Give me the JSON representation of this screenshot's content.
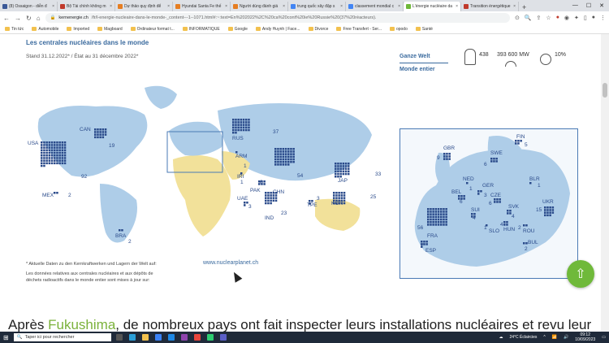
{
  "tabs": [
    {
      "label": "(8) Ossaigon - diễn đ",
      "color": "#3b5998"
    },
    {
      "label": "Bộ Tài chính không m",
      "color": "#c0392b"
    },
    {
      "label": "Dự thảo quy định để",
      "color": "#e67e22"
    },
    {
      "label": "Hyundai Santa Fe thế",
      "color": "#e67e22"
    },
    {
      "label": "Người dùng đánh giá",
      "color": "#e67e22"
    },
    {
      "label": "trung quốc xây đập s",
      "color": "#4285f4"
    },
    {
      "label": "classement mondial c",
      "color": "#4285f4"
    },
    {
      "label": "L'énergie nucléaire da",
      "color": "#6fb93a",
      "active": true
    },
    {
      "label": "Transition énergétique",
      "color": "#c0392b"
    }
  ],
  "toolbar": {
    "url_host": "kernenergie.ch",
    "url_path": "/fr/l-energie-nucleaire-dans-le-monde-_content---1--1071.html#:~:text=En%202022%2C%20ca%20cont%20ie%20Russie%20(37%20réacteurs)."
  },
  "bookmarks": [
    "Tin tức",
    "Automobile",
    "Imported",
    "Magboard",
    "Ordinateur format t...",
    "INFORMATIQUE",
    "Google",
    "Andy Huynh | Face...",
    "Divorce",
    "Free Transfert - Ser...",
    "opodo",
    "Santé"
  ],
  "map": {
    "title": "Les centrales nucléaires dans le monde",
    "subtitle": "Stand 31.12.2022* / État au 31 décembre 2022*",
    "world_label_de": "Ganze Welt",
    "world_label_fr": "Monde entier",
    "total_reactors": "438",
    "total_capacity": "393 600 MW",
    "share": "10%",
    "footnote_de": "* Aktuelle Daten zu den Kernkraftwerken und Lagern der Welt auf:",
    "footnote_fr_1": "Les données relatives aux centrales nucléaires et aux dépôts de",
    "footnote_fr_2": "déchets radioactifs dans le monde entier sont mises à jour sur:",
    "site": "www.nuclearplanet.ch",
    "world_countries": [
      {
        "code": "CAN",
        "count": "19"
      },
      {
        "code": "USA",
        "count": "92"
      },
      {
        "code": "MEX",
        "count": "2"
      },
      {
        "code": "BRA",
        "count": "2"
      },
      {
        "code": "ARG",
        "count": "3"
      },
      {
        "code": "RSA",
        "count": "2"
      },
      {
        "code": "RUS",
        "count": "37"
      },
      {
        "code": "ARM",
        "count": "1"
      },
      {
        "code": "IRI",
        "count": "1"
      },
      {
        "code": "PAK",
        "count": "6"
      },
      {
        "code": "UAE",
        "count": "3"
      },
      {
        "code": "IND",
        "count": "23"
      },
      {
        "code": "CHN",
        "count": "54"
      },
      {
        "code": "TPE",
        "count": "3"
      },
      {
        "code": "KOR",
        "count": "25"
      },
      {
        "code": "JAP",
        "count": "33"
      }
    ],
    "europe_countries": [
      {
        "code": "FIN",
        "count": "5"
      },
      {
        "code": "SWE",
        "count": "6"
      },
      {
        "code": "GBR",
        "count": "9"
      },
      {
        "code": "NED",
        "count": "1"
      },
      {
        "code": "BEL",
        "count": "6"
      },
      {
        "code": "GER",
        "count": "3"
      },
      {
        "code": "CZE",
        "count": "6"
      },
      {
        "code": "BLR",
        "count": "1"
      },
      {
        "code": "UKR",
        "count": "15"
      },
      {
        "code": "SVK",
        "count": "4"
      },
      {
        "code": "HUN",
        "count": "4"
      },
      {
        "code": "SLO",
        "count": "1"
      },
      {
        "code": "SUI",
        "count": "4"
      },
      {
        "code": "FRA",
        "count": "56"
      },
      {
        "code": "ESP",
        "count": "7"
      },
      {
        "code": "ROU",
        "count": "2"
      },
      {
        "code": "BUL",
        "count": "2"
      }
    ]
  },
  "article": {
    "before": "Après ",
    "link": "Fukushima",
    "after": ", de nombreux pays ont fait inspecter leurs installations nucléaires et revu leur"
  },
  "taskbar": {
    "search_placeholder": "Taper ici pour rechercher",
    "weather": "24°C Éclaircies",
    "time": "09:12",
    "date": "10/09/2023"
  }
}
